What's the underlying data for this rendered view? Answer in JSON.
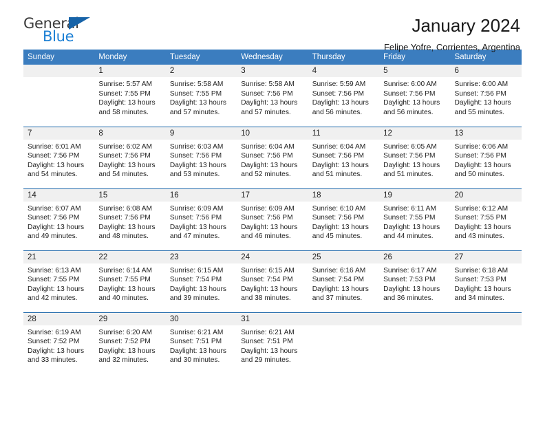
{
  "brand": {
    "name_top": "General",
    "name_bottom": "Blue",
    "accent_color": "#1b7fd4",
    "triangle_color": "#1763a8"
  },
  "header": {
    "title": "January 2024",
    "subtitle": "Felipe Yofre, Corrientes, Argentina"
  },
  "calendar": {
    "header_bg": "#3b7dbf",
    "daynum_bg": "#f0f0f0",
    "weekdays": [
      "Sunday",
      "Monday",
      "Tuesday",
      "Wednesday",
      "Thursday",
      "Friday",
      "Saturday"
    ],
    "weeks": [
      [
        {
          "day": "",
          "lines": []
        },
        {
          "day": "1",
          "lines": [
            "Sunrise: 5:57 AM",
            "Sunset: 7:55 PM",
            "Daylight: 13 hours",
            "and 58 minutes."
          ]
        },
        {
          "day": "2",
          "lines": [
            "Sunrise: 5:58 AM",
            "Sunset: 7:55 PM",
            "Daylight: 13 hours",
            "and 57 minutes."
          ]
        },
        {
          "day": "3",
          "lines": [
            "Sunrise: 5:58 AM",
            "Sunset: 7:56 PM",
            "Daylight: 13 hours",
            "and 57 minutes."
          ]
        },
        {
          "day": "4",
          "lines": [
            "Sunrise: 5:59 AM",
            "Sunset: 7:56 PM",
            "Daylight: 13 hours",
            "and 56 minutes."
          ]
        },
        {
          "day": "5",
          "lines": [
            "Sunrise: 6:00 AM",
            "Sunset: 7:56 PM",
            "Daylight: 13 hours",
            "and 56 minutes."
          ]
        },
        {
          "day": "6",
          "lines": [
            "Sunrise: 6:00 AM",
            "Sunset: 7:56 PM",
            "Daylight: 13 hours",
            "and 55 minutes."
          ]
        }
      ],
      [
        {
          "day": "7",
          "lines": [
            "Sunrise: 6:01 AM",
            "Sunset: 7:56 PM",
            "Daylight: 13 hours",
            "and 54 minutes."
          ]
        },
        {
          "day": "8",
          "lines": [
            "Sunrise: 6:02 AM",
            "Sunset: 7:56 PM",
            "Daylight: 13 hours",
            "and 54 minutes."
          ]
        },
        {
          "day": "9",
          "lines": [
            "Sunrise: 6:03 AM",
            "Sunset: 7:56 PM",
            "Daylight: 13 hours",
            "and 53 minutes."
          ]
        },
        {
          "day": "10",
          "lines": [
            "Sunrise: 6:04 AM",
            "Sunset: 7:56 PM",
            "Daylight: 13 hours",
            "and 52 minutes."
          ]
        },
        {
          "day": "11",
          "lines": [
            "Sunrise: 6:04 AM",
            "Sunset: 7:56 PM",
            "Daylight: 13 hours",
            "and 51 minutes."
          ]
        },
        {
          "day": "12",
          "lines": [
            "Sunrise: 6:05 AM",
            "Sunset: 7:56 PM",
            "Daylight: 13 hours",
            "and 51 minutes."
          ]
        },
        {
          "day": "13",
          "lines": [
            "Sunrise: 6:06 AM",
            "Sunset: 7:56 PM",
            "Daylight: 13 hours",
            "and 50 minutes."
          ]
        }
      ],
      [
        {
          "day": "14",
          "lines": [
            "Sunrise: 6:07 AM",
            "Sunset: 7:56 PM",
            "Daylight: 13 hours",
            "and 49 minutes."
          ]
        },
        {
          "day": "15",
          "lines": [
            "Sunrise: 6:08 AM",
            "Sunset: 7:56 PM",
            "Daylight: 13 hours",
            "and 48 minutes."
          ]
        },
        {
          "day": "16",
          "lines": [
            "Sunrise: 6:09 AM",
            "Sunset: 7:56 PM",
            "Daylight: 13 hours",
            "and 47 minutes."
          ]
        },
        {
          "day": "17",
          "lines": [
            "Sunrise: 6:09 AM",
            "Sunset: 7:56 PM",
            "Daylight: 13 hours",
            "and 46 minutes."
          ]
        },
        {
          "day": "18",
          "lines": [
            "Sunrise: 6:10 AM",
            "Sunset: 7:56 PM",
            "Daylight: 13 hours",
            "and 45 minutes."
          ]
        },
        {
          "day": "19",
          "lines": [
            "Sunrise: 6:11 AM",
            "Sunset: 7:55 PM",
            "Daylight: 13 hours",
            "and 44 minutes."
          ]
        },
        {
          "day": "20",
          "lines": [
            "Sunrise: 6:12 AM",
            "Sunset: 7:55 PM",
            "Daylight: 13 hours",
            "and 43 minutes."
          ]
        }
      ],
      [
        {
          "day": "21",
          "lines": [
            "Sunrise: 6:13 AM",
            "Sunset: 7:55 PM",
            "Daylight: 13 hours",
            "and 42 minutes."
          ]
        },
        {
          "day": "22",
          "lines": [
            "Sunrise: 6:14 AM",
            "Sunset: 7:55 PM",
            "Daylight: 13 hours",
            "and 40 minutes."
          ]
        },
        {
          "day": "23",
          "lines": [
            "Sunrise: 6:15 AM",
            "Sunset: 7:54 PM",
            "Daylight: 13 hours",
            "and 39 minutes."
          ]
        },
        {
          "day": "24",
          "lines": [
            "Sunrise: 6:15 AM",
            "Sunset: 7:54 PM",
            "Daylight: 13 hours",
            "and 38 minutes."
          ]
        },
        {
          "day": "25",
          "lines": [
            "Sunrise: 6:16 AM",
            "Sunset: 7:54 PM",
            "Daylight: 13 hours",
            "and 37 minutes."
          ]
        },
        {
          "day": "26",
          "lines": [
            "Sunrise: 6:17 AM",
            "Sunset: 7:53 PM",
            "Daylight: 13 hours",
            "and 36 minutes."
          ]
        },
        {
          "day": "27",
          "lines": [
            "Sunrise: 6:18 AM",
            "Sunset: 7:53 PM",
            "Daylight: 13 hours",
            "and 34 minutes."
          ]
        }
      ],
      [
        {
          "day": "28",
          "lines": [
            "Sunrise: 6:19 AM",
            "Sunset: 7:52 PM",
            "Daylight: 13 hours",
            "and 33 minutes."
          ]
        },
        {
          "day": "29",
          "lines": [
            "Sunrise: 6:20 AM",
            "Sunset: 7:52 PM",
            "Daylight: 13 hours",
            "and 32 minutes."
          ]
        },
        {
          "day": "30",
          "lines": [
            "Sunrise: 6:21 AM",
            "Sunset: 7:51 PM",
            "Daylight: 13 hours",
            "and 30 minutes."
          ]
        },
        {
          "day": "31",
          "lines": [
            "Sunrise: 6:21 AM",
            "Sunset: 7:51 PM",
            "Daylight: 13 hours",
            "and 29 minutes."
          ]
        },
        {
          "day": "",
          "lines": []
        },
        {
          "day": "",
          "lines": []
        },
        {
          "day": "",
          "lines": []
        }
      ]
    ]
  }
}
